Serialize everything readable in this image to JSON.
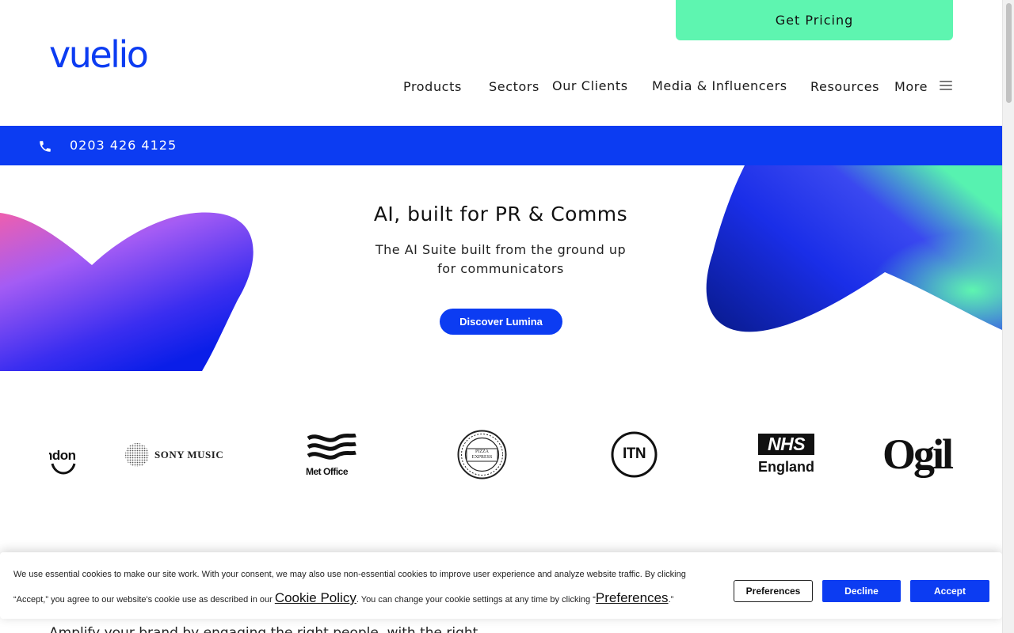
{
  "header": {
    "logo_text": "vuelio",
    "cta_label": "Get Pricing",
    "nav": [
      {
        "label": "Products"
      },
      {
        "label": "Sectors"
      },
      {
        "label": "Our Clients"
      },
      {
        "label": "Media & Influencers"
      },
      {
        "label": "Resources"
      },
      {
        "label": "More"
      }
    ],
    "menu_icon": "hamburger-icon"
  },
  "phone_bar": {
    "icon": "phone-icon",
    "number": "0203 426 4125",
    "color": "#0c3cf2"
  },
  "hero": {
    "title": "AI, built for PR & Comms",
    "subtitle_line1": "The AI Suite built from the ground up",
    "subtitle_line2": "for communicators",
    "button_label": "Discover Lumina"
  },
  "client_logos": [
    {
      "name": "ndon-logo-partial",
      "text": "ndon"
    },
    {
      "name": "sony-music-logo",
      "text": "SONY MUSIC"
    },
    {
      "name": "met-office-logo",
      "text": "Met Office"
    },
    {
      "name": "pizza-express-logo",
      "text": "PIZZA EXPRESS"
    },
    {
      "name": "itn-logo",
      "text": "ITN"
    },
    {
      "name": "nhs-england-logo",
      "text_top": "NHS",
      "text_bottom": "England"
    },
    {
      "name": "ogilvy-logo-partial",
      "text": "Ogil"
    }
  ],
  "body": {
    "intro_text": "Amplify your brand by engaging the right people, with the right"
  },
  "cookie_banner": {
    "text_part1": "We use essential cookies to make our site work. With your consent, we may also use non-essential cookies to improve user experience and analyze website traffic. By clicking",
    "text_part2": "“Accept,” you agree to our website's cookie use as described in our ",
    "cookie_policy_link": "Cookie Policy",
    "text_part3": ". You can change your cookie settings at any time by clicking “",
    "preferences_link": "Preferences",
    "text_part4": ".”",
    "preferences_button": "Preferences",
    "decline_button": "Decline",
    "accept_button": "Accept"
  },
  "colors": {
    "brand_blue": "#0c3cf2",
    "cta_green": "#5ef5b0"
  }
}
